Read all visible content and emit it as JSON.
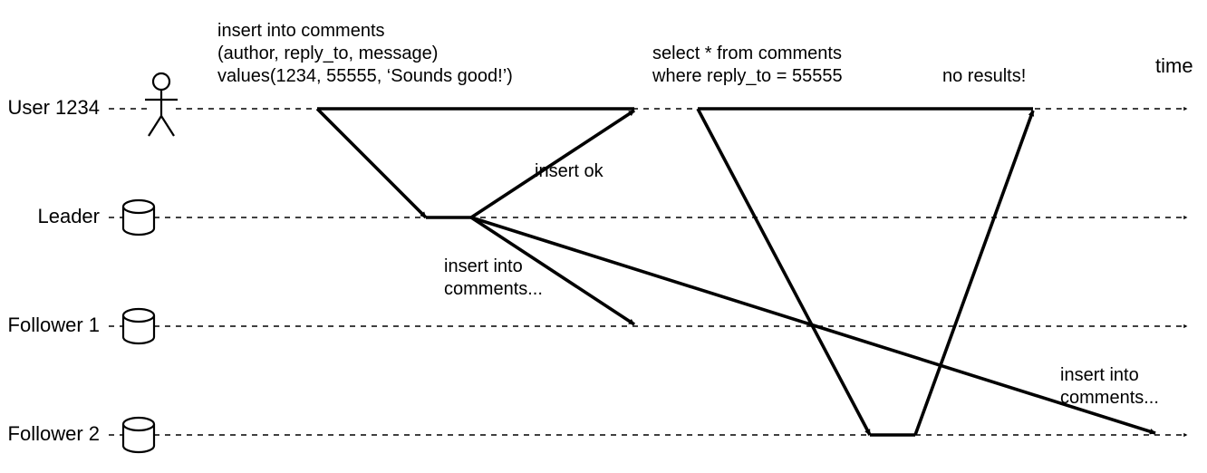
{
  "axis_label": "time",
  "lanes": {
    "user": {
      "label": "User 1234"
    },
    "leader": {
      "label": "Leader"
    },
    "follower1": {
      "label": "Follower 1"
    },
    "follower2": {
      "label": "Follower 2"
    }
  },
  "texts": {
    "insert_l1": "insert into comments",
    "insert_l2": "(author, reply_to, message)",
    "insert_l3": "values(1234, 55555, ‘Sounds good!’)",
    "insert_ok": "insert ok",
    "fwd_l1": "insert into",
    "fwd_l2": "comments...",
    "select_l1": "select * from comments",
    "select_l2": "where reply_to = 55555",
    "no_results": "no results!",
    "late_l1": "insert into",
    "late_l2": "comments..."
  }
}
